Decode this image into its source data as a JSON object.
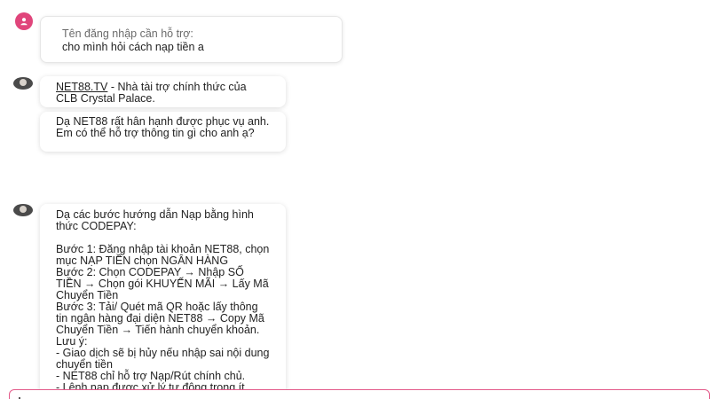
{
  "user_message": {
    "label": "Tên đăng nhập cần hỗ trợ:",
    "text": "cho mình hỏi cách nạp tiền a"
  },
  "agent_messages": [
    {
      "link_text": "NET88.TV",
      "text": " - Nhà tài trợ chính thức của CLB Crystal Palace."
    },
    {
      "text": "Dạ NET88 rất hân hạnh được phục vụ anh. Em có thể hỗ trợ thông tin gì cho anh ạ?"
    },
    {
      "text": "Dạ các bước hướng dẫn Nạp bằng hình thức CODEPAY:\n\nBước 1: Đăng nhập tài khoản NET88, chọn mục NẠP TIỀN chọn NGÂN HÀNG\nBước 2: Chọn CODEPAY → Nhập SỐ TIỀN → Chọn gói KHUYẾN MÃI → Lấy Mã Chuyển Tiền\nBước 3: Tải/ Quét mã QR hoặc lấy thông tin ngân hàng đại diện NET88 → Copy Mã Chuyển Tiền → Tiến hành chuyển khoản.\nLưu ý:\n- Giao dịch sẽ bị hủy nếu nhập sai nội dung chuyển tiền\n- NET88 chỉ hỗ trợ Nạp/Rút chính chủ.\n- Lệnh nạp được xử lý tự động trong ít phút."
    }
  ],
  "icons": {
    "user_avatar": "user-icon",
    "agent_avatar": "agent-avatar-icon"
  },
  "colors": {
    "accent": "#e0457b",
    "input_border": "#e35a8a"
  }
}
